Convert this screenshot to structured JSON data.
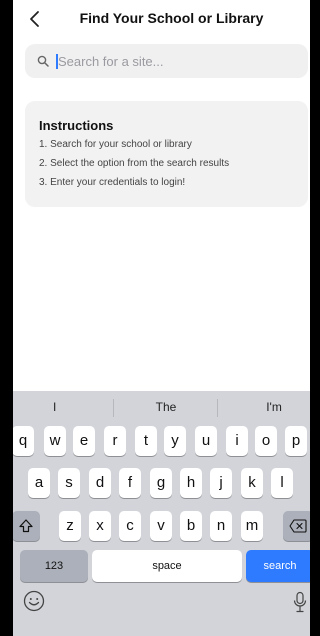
{
  "header": {
    "title": "Find Your School or Library"
  },
  "search": {
    "placeholder": "Search for a site..."
  },
  "instructions": {
    "heading": "Instructions",
    "steps": [
      "1. Search for your school or library",
      "2. Select the option from the search results",
      "3. Enter your credentials to login!"
    ]
  },
  "keyboard": {
    "suggestions": [
      "I",
      "The",
      "I'm"
    ],
    "row1": [
      "q",
      "w",
      "e",
      "r",
      "t",
      "y",
      "u",
      "i",
      "o",
      "p"
    ],
    "row2": [
      "a",
      "s",
      "d",
      "f",
      "g",
      "h",
      "j",
      "k",
      "l"
    ],
    "row3": [
      "z",
      "x",
      "c",
      "v",
      "b",
      "n",
      "m"
    ],
    "numbers_label": "123",
    "space_label": "space",
    "search_label": "search"
  },
  "colors": {
    "accent": "#2f7bff",
    "keyboard_bg": "#d2d4d9"
  }
}
